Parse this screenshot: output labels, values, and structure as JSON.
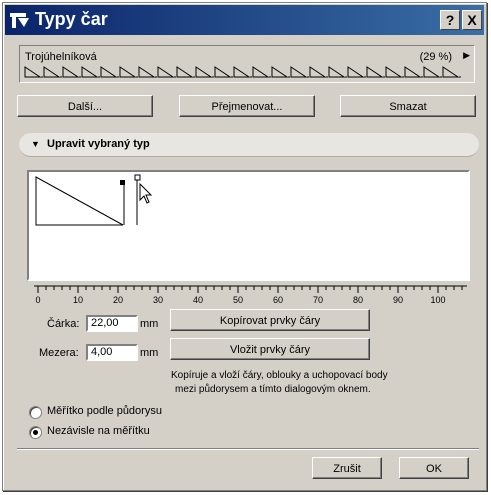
{
  "window": {
    "title": "Typy čar",
    "help_button": "?",
    "close_button": "X"
  },
  "linetype": {
    "name": "Trojúhelníková",
    "scale_percent": "(29 %)"
  },
  "actions": {
    "next_label": "Další...",
    "rename_label": "Přejmenovat...",
    "delete_label": "Smazat"
  },
  "section": {
    "title": "Upravit vybraný typ"
  },
  "ruler": {
    "labels": [
      "0",
      "10",
      "20",
      "30",
      "40",
      "50",
      "60",
      "70",
      "80",
      "90",
      "100"
    ]
  },
  "dash": {
    "label": "Čárka:",
    "value": "22,00",
    "unit": "mm"
  },
  "gap": {
    "label": "Mezera:",
    "value": "4,00",
    "unit": "mm"
  },
  "copy_elements_label": "Kopírovat prvky čáry",
  "paste_elements_label": "Vložit prvky čáry",
  "info": {
    "line1": "Kopíruje a vloží čáry, oblouky a uchopovací body",
    "line2": "mezi půdorysem a tímto dialogovým oknem."
  },
  "scale_options": [
    {
      "label": "Měřítko podle půdorysu",
      "selected": false
    },
    {
      "label": "Nezávisle na měřítku",
      "selected": true
    }
  ],
  "footer": {
    "cancel_label": "Zrušit",
    "ok_label": "OK"
  }
}
